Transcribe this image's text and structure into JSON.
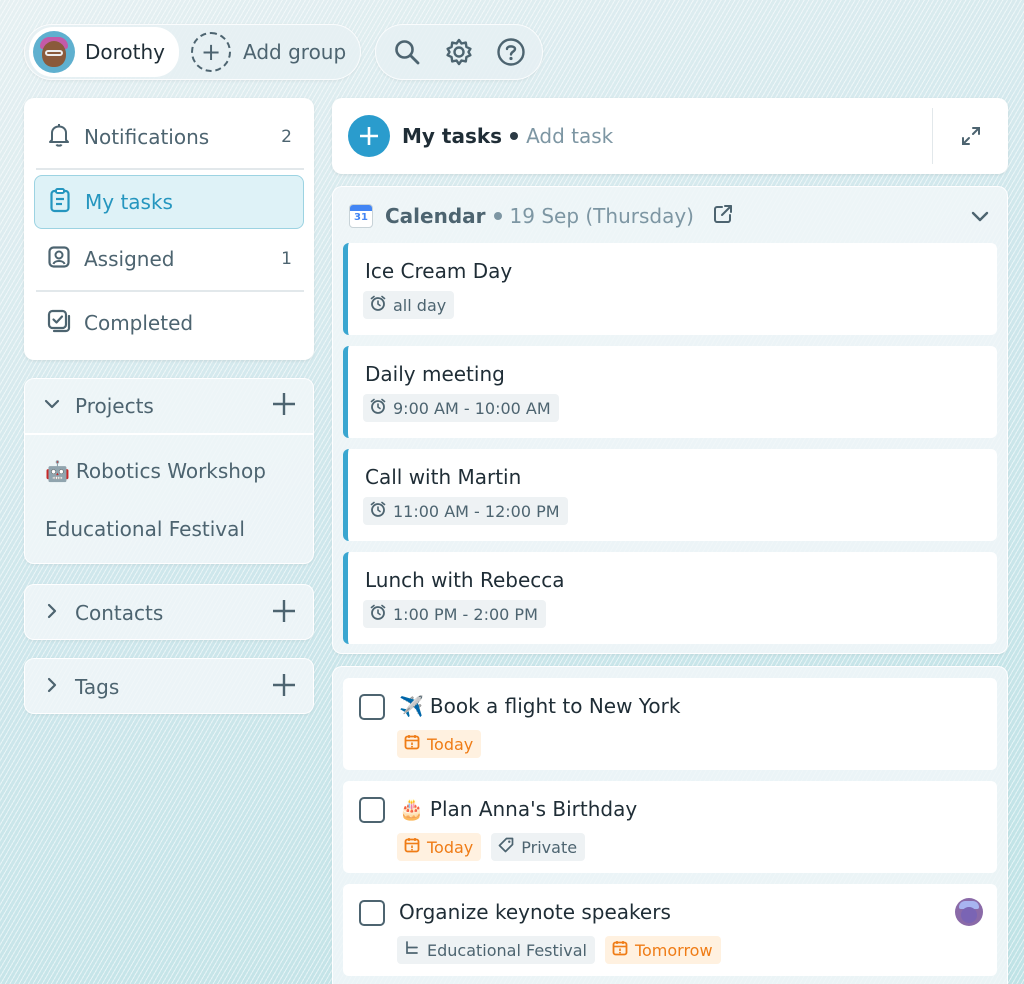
{
  "header": {
    "user_name": "Dorothy",
    "add_group_label": "Add group",
    "tool_icons": [
      "search-icon",
      "gear-icon",
      "help-icon"
    ]
  },
  "sidebar": {
    "nav": [
      {
        "label": "Notifications",
        "count": "2",
        "icon": "bell-icon"
      },
      {
        "label": "My tasks",
        "count": "",
        "icon": "clipboard-icon",
        "active": true
      },
      {
        "label": "Assigned",
        "count": "1",
        "icon": "contact-icon"
      },
      {
        "label": "Completed",
        "count": "",
        "icon": "check-stack-icon"
      }
    ],
    "projects": {
      "title": "Projects",
      "items": [
        {
          "emoji": "🤖",
          "label": "Robotics Workshop"
        },
        {
          "emoji": "",
          "label": "Educational Festival"
        }
      ]
    },
    "contacts": {
      "title": "Contacts"
    },
    "tags": {
      "title": "Tags"
    }
  },
  "main": {
    "title": "My tasks",
    "add_task_placeholder": "Add task",
    "calendar": {
      "icon_day": "31",
      "title": "Calendar",
      "date": "19 Sep (Thursday)",
      "events": [
        {
          "title": "Ice Cream Day",
          "time": "all day"
        },
        {
          "title": "Daily meeting",
          "time": "9:00 AM - 10:00 AM"
        },
        {
          "title": "Call with Martin",
          "time": "11:00 AM - 12:00 PM"
        },
        {
          "title": "Lunch with Rebecca",
          "time": "1:00 PM - 2:00 PM"
        }
      ]
    },
    "tasks": [
      {
        "emoji": "✈️",
        "title": "Book a flight to New York",
        "tags": [
          {
            "label": "Today",
            "type": "due"
          }
        ]
      },
      {
        "emoji": "🎂",
        "title": "Plan Anna's Birthday",
        "tags": [
          {
            "label": "Today",
            "type": "due"
          },
          {
            "label": "Private",
            "type": "tag"
          }
        ]
      },
      {
        "emoji": "",
        "title": "Organize keynote speakers",
        "tags": [
          {
            "label": "Educational Festival",
            "type": "project"
          },
          {
            "label": "Tomorrow",
            "type": "due"
          }
        ]
      }
    ]
  },
  "colors": {
    "accent": "#2a9ccd",
    "due_orange": "#ef7c16",
    "active_bg": "#def2f7"
  }
}
